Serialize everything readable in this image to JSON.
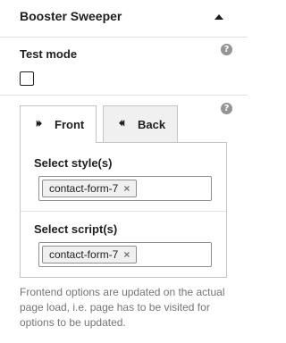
{
  "panel": {
    "title": "Booster Sweeper",
    "toggle_icon": "caret-up-icon"
  },
  "test_mode": {
    "label": "Test mode",
    "checked": false,
    "help_icon": "?"
  },
  "tabs": {
    "help_icon": "?",
    "items": [
      {
        "label": "Front",
        "icon": "⏵⏵",
        "active": true
      },
      {
        "label": "Back",
        "icon": "⏴⏴",
        "active": false
      }
    ]
  },
  "styles": {
    "label": "Select style(s)",
    "tokens": [
      {
        "text": "contact-form-7",
        "remove": "×"
      }
    ]
  },
  "scripts": {
    "label": "Select script(s)",
    "tokens": [
      {
        "text": "contact-form-7",
        "remove": "×"
      }
    ]
  },
  "note": "Frontend options are updated on the actual page load, i.e. page has to be visited for options to be updated.",
  "colors": {
    "text": "#1e1e1e",
    "muted": "#757575",
    "border": "#c3c4c7",
    "help_bg": "#949494"
  }
}
